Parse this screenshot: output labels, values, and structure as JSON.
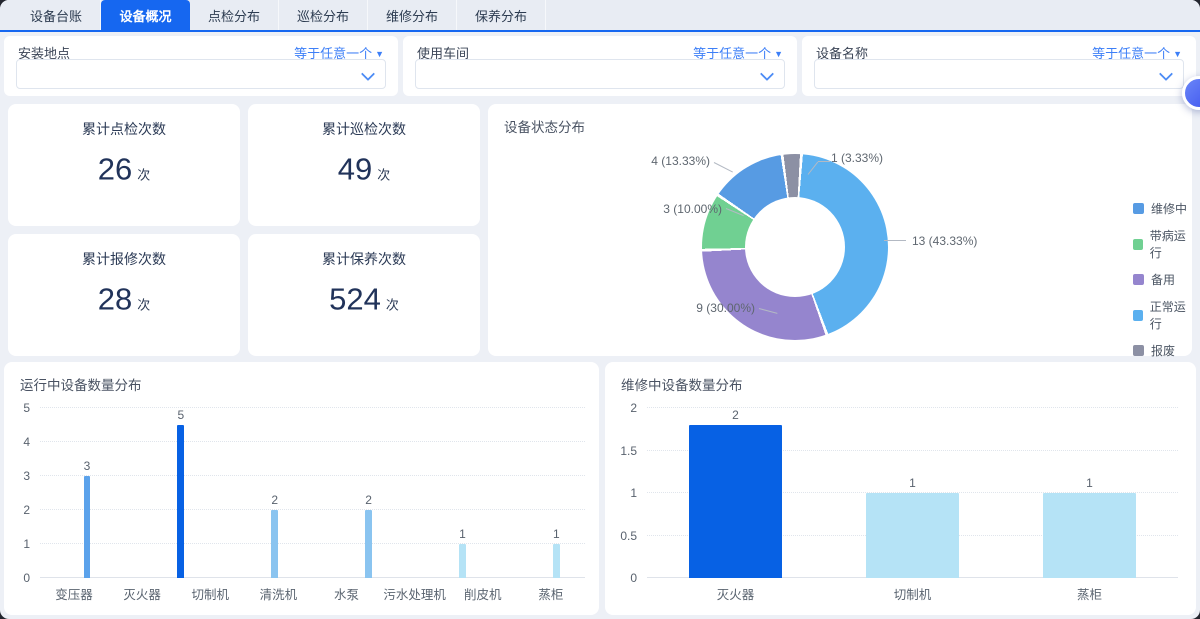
{
  "tabs": [
    {
      "label": "设备台账",
      "active": false
    },
    {
      "label": "设备概况",
      "active": true
    },
    {
      "label": "点检分布",
      "active": false
    },
    {
      "label": "巡检分布",
      "active": false
    },
    {
      "label": "维修分布",
      "active": false
    },
    {
      "label": "保养分布",
      "active": false
    }
  ],
  "filters": {
    "operator_label": "等于任意一个",
    "operator_arrow": "▼",
    "items": [
      {
        "label": "安装地点",
        "value": ""
      },
      {
        "label": "使用车间",
        "value": ""
      },
      {
        "label": "设备名称",
        "value": ""
      }
    ]
  },
  "stats": [
    {
      "title": "累计点检次数",
      "value": "26",
      "unit": "次"
    },
    {
      "title": "累计巡检次数",
      "value": "49",
      "unit": "次"
    },
    {
      "title": "累计报修次数",
      "value": "28",
      "unit": "次"
    },
    {
      "title": "累计保养次数",
      "value": "524",
      "unit": "次"
    }
  ],
  "colors": {
    "active_tab": "#1667f0",
    "link_blue": "#3d7ff7",
    "page_bg": "#edf0f6",
    "deep_bar_blue": "#0761e4"
  },
  "chart_data": [
    {
      "type": "pie",
      "title": "设备状态分布",
      "donut": true,
      "start_angle_deg": 4,
      "slices": [
        {
          "name": "正常运行",
          "value": 13,
          "pct": 43.33,
          "label": "13 (43.33%)",
          "color": "#5bb0ef"
        },
        {
          "name": "备用",
          "value": 9,
          "pct": 30.0,
          "label": "9 (30.00%)",
          "color": "#9585ce"
        },
        {
          "name": "带病运行",
          "value": 3,
          "pct": 10.0,
          "label": "3 (10.00%)",
          "color": "#70d092"
        },
        {
          "name": "维修中",
          "value": 4,
          "pct": 13.33,
          "label": "4 (13.33%)",
          "color": "#579be3"
        },
        {
          "name": "报废",
          "value": 1,
          "pct": 3.33,
          "label": "1 (3.33%)",
          "color": "#8c90a4"
        }
      ],
      "legend": [
        {
          "label": "维修中",
          "color": "#579be3"
        },
        {
          "label": "带病运行",
          "color": "#70d092"
        },
        {
          "label": "备用",
          "color": "#9585ce"
        },
        {
          "label": "正常运行",
          "color": "#5bb0ef"
        },
        {
          "label": "报废",
          "color": "#8c90a4"
        }
      ],
      "legend_position": "right"
    },
    {
      "type": "bar",
      "title": "运行中设备数量分布",
      "categories": [
        "变压器",
        "灭火器",
        "切制机",
        "清洗机",
        "水泵",
        "污水处理机",
        "削皮机",
        "蒸柜"
      ],
      "values": [
        3,
        5,
        2,
        2,
        1,
        1,
        1,
        1
      ],
      "bar_colors": [
        "#5ba2eb",
        "#0761e4",
        "#8ac4f0",
        "#8ac4f0",
        "#b5e3f6",
        "#b5e3f6",
        "#b5e3f6",
        "#b5e3f6"
      ],
      "yticks": [
        "0",
        "1",
        "2",
        "3",
        "4",
        "5"
      ],
      "ylim": [
        0,
        5
      ],
      "grid": "dotted",
      "xlabel": "",
      "ylabel": ""
    },
    {
      "type": "bar",
      "title": "维修中设备数量分布",
      "categories": [
        "灭火器",
        "切制机",
        "蒸柜"
      ],
      "values": [
        2,
        1,
        1
      ],
      "bar_colors": [
        "#0761e4",
        "#b5e3f6",
        "#b5e3f6"
      ],
      "yticks": [
        "0",
        "0.5",
        "1",
        "1.5",
        "2"
      ],
      "ylim": [
        0,
        2
      ],
      "grid": "dotted",
      "xlabel": "",
      "ylabel": ""
    }
  ]
}
